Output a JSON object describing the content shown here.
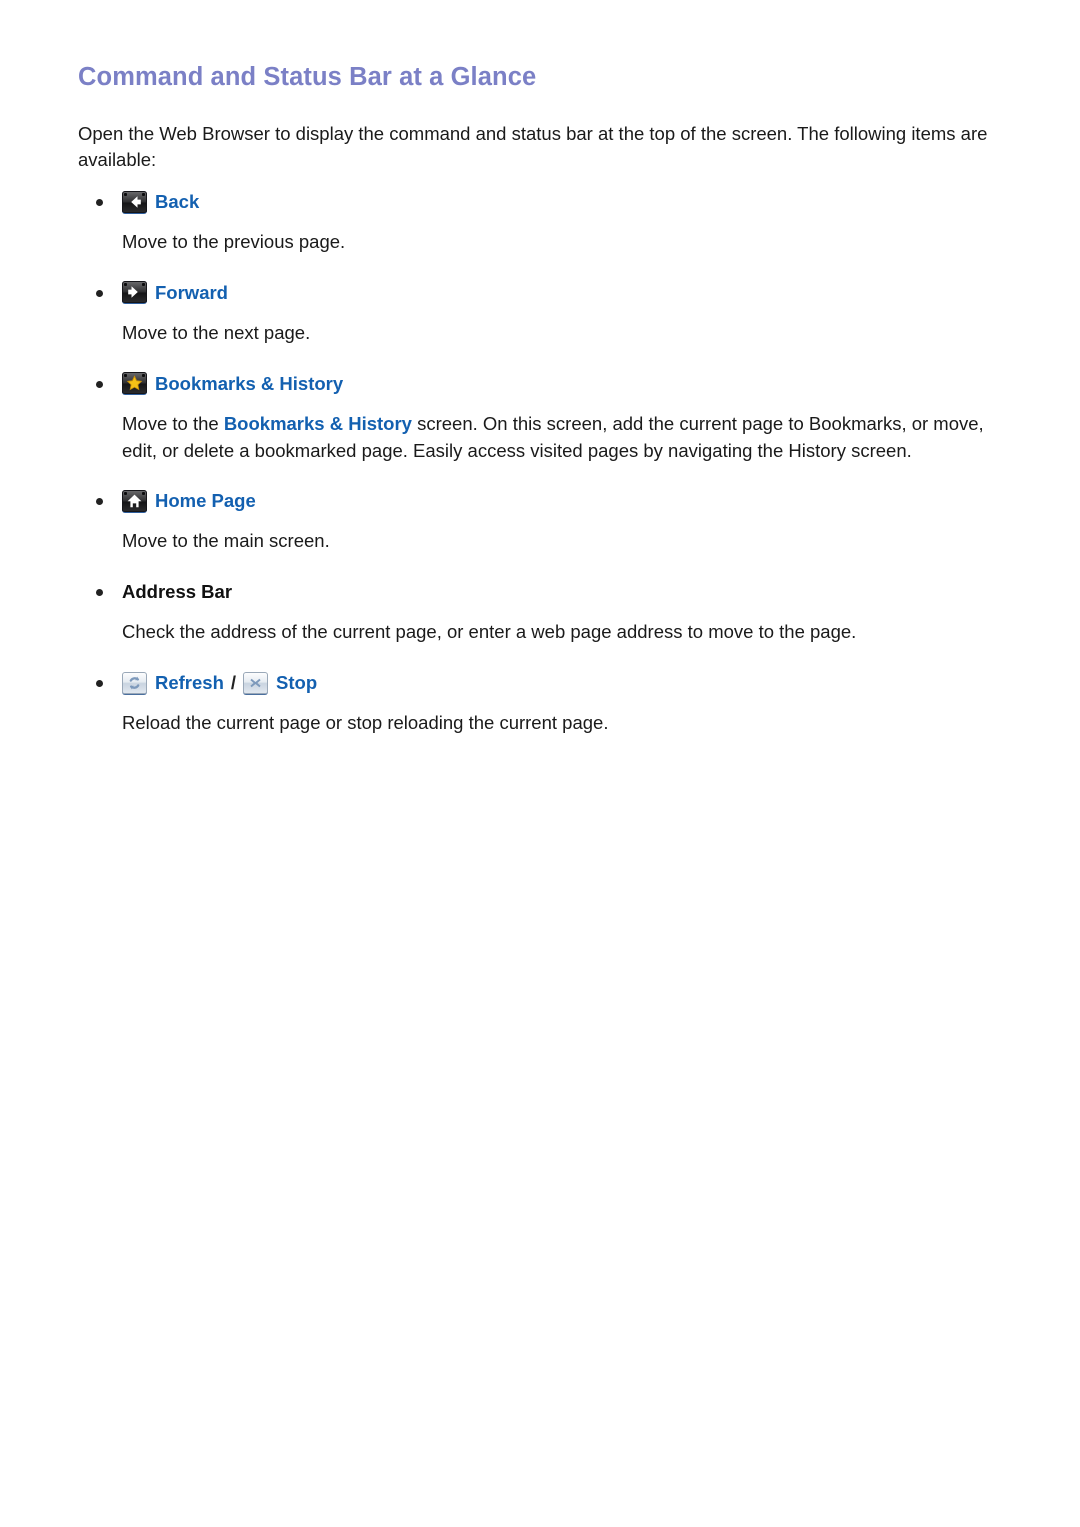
{
  "document": {
    "title": "Command and Status Bar at a Glance",
    "intro": "Open the Web Browser to display the command and status bar at the top of the screen. The following items are available:"
  },
  "colors": {
    "title": "#7b80c6",
    "link": "#1360b0",
    "body_text": "#1a1a1a",
    "icon_dark": "#2b2b2d",
    "icon_light": "#e0e7ef",
    "star_gold": "#f5c117",
    "page_background": "#ffffff"
  },
  "items": [
    {
      "icon": "back-arrow-icon",
      "label": "Back",
      "description": "Move to the previous page."
    },
    {
      "icon": "forward-arrow-icon",
      "label": "Forward",
      "description": "Move to the next page."
    },
    {
      "icon": "star-bookmark-icon",
      "label": "Bookmarks & History",
      "description_pre": "Move to the ",
      "description_highlight": "Bookmarks & History",
      "description_post": " screen. On this screen, add the current page to Bookmarks, or move, edit, or delete a bookmarked page. Easily access visited pages by navigating the History screen."
    },
    {
      "icon": "home-house-icon",
      "label": "Home Page",
      "description": "Move to the main screen."
    },
    {
      "icon": null,
      "label": "Address Bar",
      "description": "Check the address of the current page, or enter a web page address to move to the page."
    },
    {
      "icon": "refresh-icon",
      "label": "Refresh",
      "separator": "/",
      "icon2": "stop-close-icon",
      "label2": "Stop",
      "description": "Reload the current page or stop reloading the current page."
    }
  ]
}
